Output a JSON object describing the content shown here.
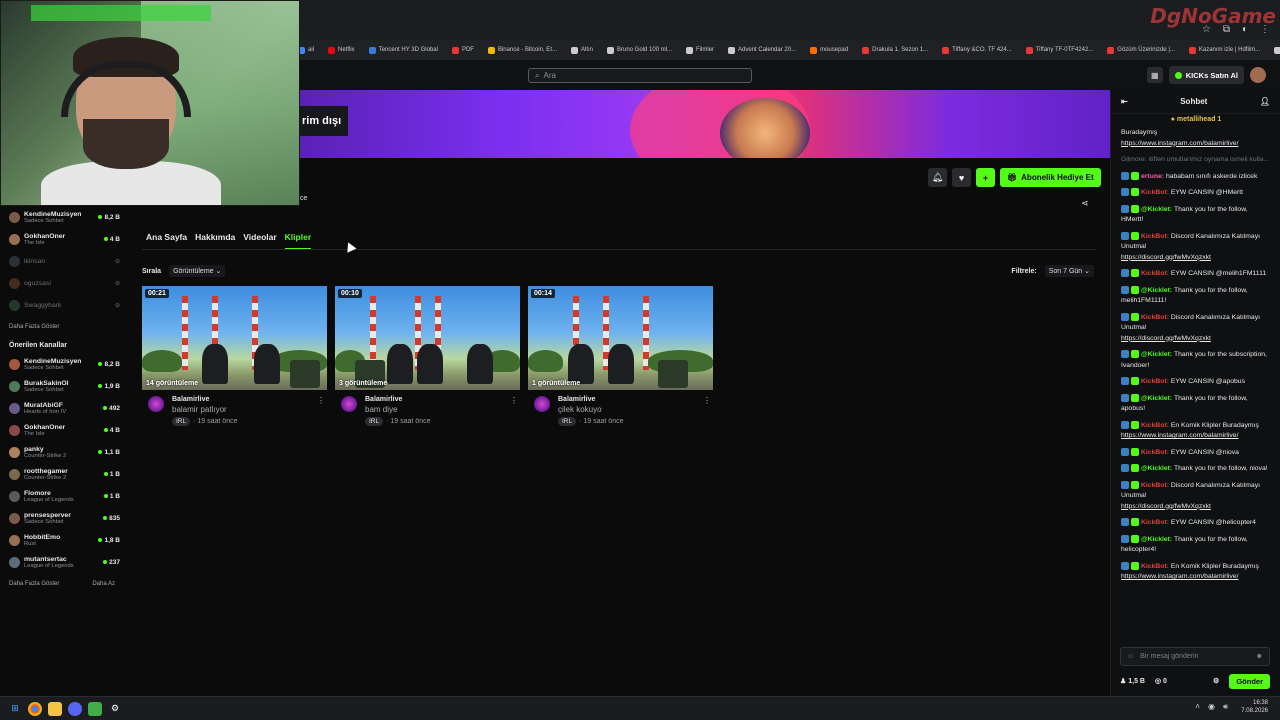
{
  "browser": {
    "brand": "DgNoGame",
    "bookmarks": [
      {
        "label": "ail",
        "color": "#4285f4"
      },
      {
        "label": "Netflix",
        "color": "#e50914"
      },
      {
        "label": "Tencent HY 3D Global",
        "color": "#3a7bd5"
      },
      {
        "label": "PDF",
        "color": "#e53935"
      },
      {
        "label": "Binance - Bitcoin, Et...",
        "color": "#f0b90b"
      },
      {
        "label": "Altın",
        "color": "#cccccc"
      },
      {
        "label": "Bruno Gold 100 ml...",
        "color": "#cccccc"
      },
      {
        "label": "Filmler",
        "color": "#cccccc"
      },
      {
        "label": "Advent Calendar 20...",
        "color": "#cccccc"
      },
      {
        "label": "mousepad",
        "color": "#ff6d00"
      },
      {
        "label": "Drakula 1. Sezon 1...",
        "color": "#e53935"
      },
      {
        "label": "Tiffany &CO. TF 424...",
        "color": "#e53935"
      },
      {
        "label": "Tiffany TF-0TF4242...",
        "color": "#e53935"
      },
      {
        "label": "Gözüm Üzerinizde |...",
        "color": "#e53935"
      },
      {
        "label": "Kazanım izle | Hdfilm...",
        "color": "#e53935"
      },
      {
        "label": "arabalar",
        "color": "#cccccc"
      }
    ]
  },
  "header": {
    "search_placeholder": "Ara",
    "kicks_label": "KICKs Satın Al"
  },
  "channel": {
    "offline_label": "rim dışı",
    "name_fragment": "ce",
    "gift_label": "Abonelik Hediye Et"
  },
  "tabs": [
    {
      "label": "Ana Sayfa",
      "active": false
    },
    {
      "label": "Hakkımda",
      "active": false
    },
    {
      "label": "Videolar",
      "active": false
    },
    {
      "label": "Klipler",
      "active": true
    }
  ],
  "sort": {
    "label": "Sırala",
    "value": "Görüntüleme"
  },
  "filter": {
    "label": "Filtrele:",
    "value": "Son 7 Gün"
  },
  "clips": [
    {
      "duration": "00:21",
      "views": "14 görüntüleme",
      "channel": "Balamirlive",
      "title": "balamir patlıyor",
      "tag": "IRL",
      "age": "· 19 saat önce"
    },
    {
      "duration": "00:10",
      "views": "3 görüntüleme",
      "channel": "Balamirlive",
      "title": "bam diye",
      "tag": "IRL",
      "age": "· 19 saat önce"
    },
    {
      "duration": "00:14",
      "views": "1 görüntüleme",
      "channel": "Balamirlive",
      "title": "çilek kokuyo",
      "tag": "IRL",
      "age": "· 19 saat önce"
    }
  ],
  "sidebar": {
    "followed": [
      {
        "name": "KendineMuzisyen",
        "game": "Sadece Sohbet",
        "count": "8,2 B",
        "online": true
      },
      {
        "name": "GokhanOner",
        "game": "The Isle",
        "count": "4 B",
        "online": true
      },
      {
        "name": "lkinsan",
        "game": "",
        "count": "",
        "online": false
      },
      {
        "name": "oguzsasi",
        "game": "",
        "count": "",
        "online": false
      },
      {
        "name": "Swaggybark",
        "game": "",
        "count": "",
        "online": false
      }
    ],
    "show_more": "Daha Fazla Göster",
    "recommended_title": "Önerilen Kanallar",
    "recommended": [
      {
        "name": "KendineMuzisyen",
        "game": "Sadece Sohbet",
        "count": "8,2 B"
      },
      {
        "name": "BurakSakinOl",
        "game": "Sadece Sohbet",
        "count": "1,9 B"
      },
      {
        "name": "MuratAbiGF",
        "game": "Hearts of Iron IV",
        "count": "492"
      },
      {
        "name": "GokhanOner",
        "game": "The Isle",
        "count": "4 B"
      },
      {
        "name": "panky",
        "game": "Counter-Strike 2",
        "count": "1,1 B"
      },
      {
        "name": "rootthegamer",
        "game": "Counter-Strike 2",
        "count": "1 B"
      },
      {
        "name": "Flomore",
        "game": "League of Legends",
        "count": "1 B"
      },
      {
        "name": "prensesperver",
        "game": "Sadece Sohbet",
        "count": "835"
      },
      {
        "name": "HobbitEmo",
        "game": "Rust",
        "count": "1,8 B"
      },
      {
        "name": "mutantsertac",
        "game": "League of Legends",
        "count": "237"
      }
    ],
    "show_more_2": "Daha Fazla Göster",
    "show_less": "Daha Az"
  },
  "chat": {
    "title": "Sohbet",
    "pinned_user": "metallihead",
    "pinned_count": "1",
    "messages": [
      {
        "user": "",
        "user_class": "",
        "text": "Buradaymış",
        "link": "https://www.instagram.com/balamirlive/"
      },
      {
        "user": "",
        "user_class": "faded",
        "text": "Gilmore: itiften umutlarımız oynama ismeli kulla...",
        "link": ""
      },
      {
        "user": "ertune:",
        "user_class": "u-pink",
        "text": "hababam sınıfı askerde izlicek",
        "link": ""
      },
      {
        "user": "KickBot:",
        "user_class": "u-red",
        "text": "EYW CANSIN @HMertt",
        "link": ""
      },
      {
        "user": "@Kicklet:",
        "user_class": "u-green",
        "text": "Thank you for the follow, HMertt!",
        "link": ""
      },
      {
        "user": "KickBot:",
        "user_class": "u-red",
        "text": "Discord Kanalımıza Katılmayı Unutma!",
        "link": "https://discord.gg/fwMvXqzxkt"
      },
      {
        "user": "KickBot:",
        "user_class": "u-red",
        "text": "EYW CANSIN @melih1FM1111",
        "link": ""
      },
      {
        "user": "@Kicklet:",
        "user_class": "u-green",
        "text": "Thank you for the follow, melih1FM1111!",
        "link": ""
      },
      {
        "user": "KickBot:",
        "user_class": "u-red",
        "text": "Discord Kanalımıza Katılmayı Unutma!",
        "link": "https://discord.gg/fwMvXqzxkt"
      },
      {
        "user": "@Kicklet:",
        "user_class": "u-green",
        "text": "Thank you for the subscription, Ivandoer!",
        "link": ""
      },
      {
        "user": "KickBot:",
        "user_class": "u-red",
        "text": "EYW CANSIN @apobus",
        "link": ""
      },
      {
        "user": "@Kicklet:",
        "user_class": "u-green",
        "text": "Thank you for the follow, apobus!",
        "link": ""
      },
      {
        "user": "KickBot:",
        "user_class": "u-red",
        "text": "En Komik Klipler Buradaymış",
        "link": "https://www.instagram.com/balamirlive/"
      },
      {
        "user": "KickBot:",
        "user_class": "u-red",
        "text": "EYW CANSIN @niova",
        "link": ""
      },
      {
        "user": "@Kicklet:",
        "user_class": "u-green",
        "text": "Thank you for the follow, niova!",
        "link": ""
      },
      {
        "user": "KickBot:",
        "user_class": "u-red",
        "text": "Discord Kanalımıza Katılmayı Unutma!",
        "link": "https://discord.gg/fwMvXqzxkt"
      },
      {
        "user": "KickBot:",
        "user_class": "u-red",
        "text": "EYW CANSIN @helicopter4",
        "link": ""
      },
      {
        "user": "@Kicklet:",
        "user_class": "u-green",
        "text": "Thank you for the follow, helicopter4!",
        "link": ""
      },
      {
        "user": "KickBot:",
        "user_class": "u-red",
        "text": "En Komik Klipler Buradaymış",
        "link": "https://www.instagram.com/balamirlive/"
      }
    ],
    "input_placeholder": "Bir mesaj gönderin",
    "viewer_count": "1,5 B",
    "kicks_count": "0",
    "send_label": "Gönder"
  },
  "taskbar": {
    "time": "16:38",
    "date": "7.08.2026"
  }
}
